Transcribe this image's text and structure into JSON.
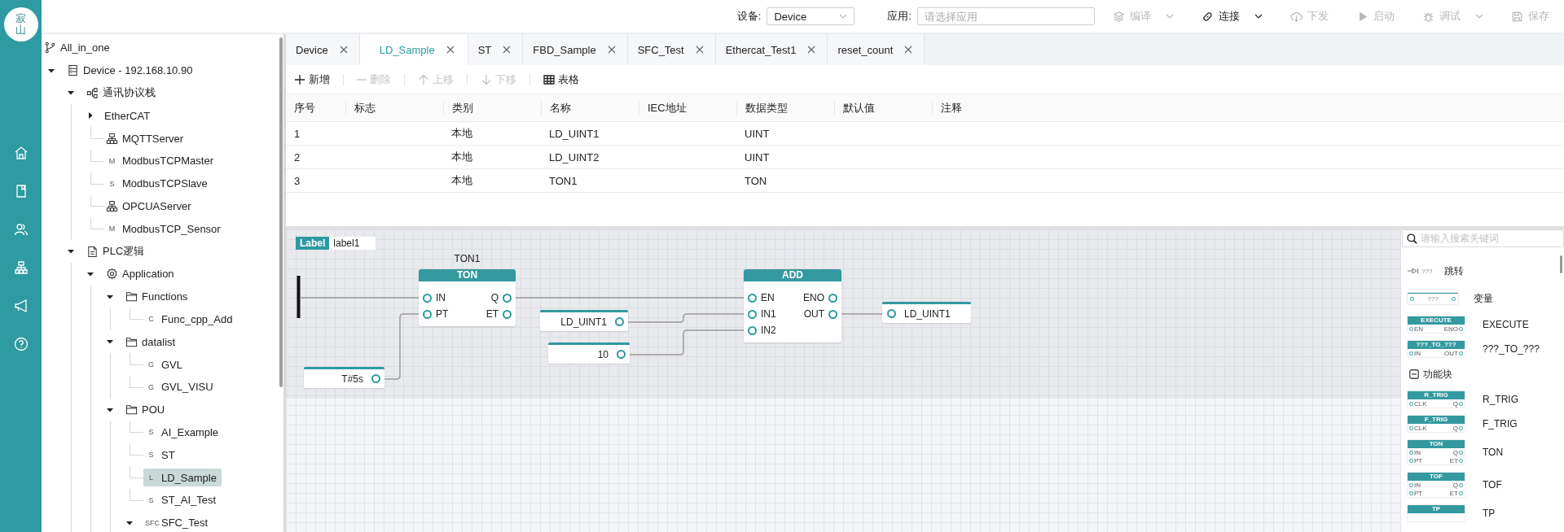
{
  "rail": {
    "logo_text": "寂山",
    "nav": [
      {
        "kind": "home"
      },
      {
        "kind": "book"
      },
      {
        "kind": "users"
      },
      {
        "kind": "network"
      },
      {
        "kind": "megaphone"
      },
      {
        "kind": "help"
      }
    ]
  },
  "topbar": {
    "device_label": "设备:",
    "device": "Device",
    "app_label": "应用:",
    "app_placeholder": "请选择应用",
    "actions": [
      {
        "kind": "compile",
        "label": "编译",
        "disabled": true,
        "dropdown": true
      },
      {
        "kind": "link",
        "label": "连接",
        "disabled": false,
        "dropdown": true
      },
      {
        "kind": "download",
        "label": "下发",
        "disabled": true,
        "dropdown": false
      },
      {
        "kind": "start",
        "label": "启动",
        "disabled": true,
        "dropdown": false
      },
      {
        "kind": "debug",
        "label": "调试",
        "disabled": true,
        "dropdown": true
      },
      {
        "kind": "save",
        "label": "保存",
        "disabled": true,
        "dropdown": false
      }
    ]
  },
  "tree": {
    "items": [
      {
        "label": "All_in_one",
        "kind": "branch",
        "selected": false,
        "children": [
          {
            "label": "Device - 192.168.10.90",
            "kind": "device",
            "selected": false,
            "expanded": true,
            "children": [
              {
                "label": "通讯协议栈",
                "kind": "nodes",
                "selected": false,
                "expanded": true,
                "children": [
                  {
                    "label": "EtherCAT",
                    "selected": false,
                    "expanded": false
                  },
                  {
                    "label": "MQTTServer",
                    "kind": "server",
                    "selected": false
                  },
                  {
                    "label": "ModbusTCPMaster",
                    "badge": "M",
                    "selected": false
                  },
                  {
                    "label": "ModbusTCPSlave",
                    "badge": "S",
                    "selected": false
                  },
                  {
                    "label": "OPCUAServer",
                    "kind": "server",
                    "selected": false
                  },
                  {
                    "label": "ModbusTCP_Sensor",
                    "badge": "M",
                    "selected": false
                  }
                ]
              },
              {
                "label": "PLC逻辑",
                "kind": "document",
                "selected": false,
                "expanded": true,
                "children": [
                  {
                    "label": "Application",
                    "kind": "gear",
                    "selected": false,
                    "expanded": true,
                    "children": [
                      {
                        "label": "Functions",
                        "kind": "folder",
                        "selected": false,
                        "expanded": true,
                        "children": [
                          {
                            "label": "Func_cpp_Add",
                            "badge": "C",
                            "selected": false
                          }
                        ]
                      },
                      {
                        "label": "datalist",
                        "kind": "folder",
                        "selected": false,
                        "expanded": true,
                        "children": [
                          {
                            "label": "GVL",
                            "badge": "G",
                            "selected": false
                          },
                          {
                            "label": "GVL_VISU",
                            "badge": "G",
                            "selected": false
                          }
                        ]
                      },
                      {
                        "label": "POU",
                        "kind": "folder",
                        "selected": false,
                        "expanded": true,
                        "children": [
                          {
                            "label": "AI_Example",
                            "badge": "S",
                            "selected": false
                          },
                          {
                            "label": "ST",
                            "badge": "S",
                            "selected": false
                          },
                          {
                            "label": "LD_Sample",
                            "badge": "L",
                            "selected": true
                          },
                          {
                            "label": "ST_AI_Test",
                            "badge": "S",
                            "selected": false
                          },
                          {
                            "label": "SFC_Test",
                            "badge": "SFC",
                            "selected": false,
                            "expanded": true
                          }
                        ]
                      }
                    ]
                  }
                ]
              }
            ]
          }
        ]
      }
    ]
  },
  "tabs": [
    {
      "label": "Device",
      "selected": false
    },
    {
      "label": "LD_Sample",
      "selected": true
    },
    {
      "label": "ST",
      "selected": false
    },
    {
      "label": "FBD_Sample",
      "selected": false
    },
    {
      "label": "SFC_Test",
      "selected": false
    },
    {
      "label": "Ethercat_Test1",
      "selected": false
    },
    {
      "label": "reset_count",
      "selected": false
    }
  ],
  "toolbar": [
    {
      "kind": "add",
      "label": "新增",
      "disabled": false
    },
    {
      "kind": "remove",
      "label": "删除",
      "disabled": true
    },
    {
      "kind": "up",
      "label": "上移",
      "disabled": true
    },
    {
      "kind": "down",
      "label": "下移",
      "disabled": true
    },
    {
      "kind": "table",
      "label": "表格",
      "disabled": false
    }
  ],
  "table": {
    "columns": [
      "序号",
      "标志",
      "类别",
      "名称",
      "IEC地址",
      "数据类型",
      "默认值",
      "注释"
    ],
    "rows": [
      {
        "index": "1",
        "category": "本地",
        "name": "LD_UINT1",
        "data_type": "UINT"
      },
      {
        "index": "2",
        "category": "本地",
        "name": "LD_UINT2",
        "data_type": "UINT"
      },
      {
        "index": "3",
        "category": "本地",
        "name": "TON1",
        "data_type": "TON"
      }
    ]
  },
  "network": {
    "label": {
      "tag": "Label",
      "name": "label1"
    },
    "blocks": [
      {
        "instance": "TON1",
        "type": "TON",
        "inputs": [
          "IN",
          "PT"
        ],
        "outputs": [
          "Q",
          "ET"
        ]
      },
      {
        "type": "ADD",
        "inputs": [
          "EN",
          "IN1",
          "IN2"
        ],
        "outputs": [
          "ENO",
          "OUT"
        ]
      }
    ],
    "variables": [
      {
        "kind": "input",
        "name": "LD_UINT1"
      },
      {
        "kind": "input",
        "name": "10"
      },
      {
        "kind": "input",
        "name": "T#5s"
      },
      {
        "kind": "output",
        "name": "LD_UINT1"
      }
    ]
  },
  "palette": {
    "search_placeholder": "请输入搜索关键词",
    "items": [
      {
        "kind": "jump",
        "preview": "???",
        "label": "跳转"
      },
      {
        "kind": "variable",
        "preview": "???",
        "label": "变量"
      },
      {
        "kind": "block",
        "title": "EXECUTE",
        "inputs": [
          "EN"
        ],
        "outputs": [
          "ENO"
        ],
        "label": "EXECUTE"
      },
      {
        "kind": "block",
        "title": "???_TO_???",
        "inputs": [
          "IN"
        ],
        "outputs": [
          "OUT"
        ],
        "label": "???_TO_???"
      },
      {
        "kind": "group",
        "label": "功能块",
        "expanded": true
      },
      {
        "kind": "block",
        "title": "R_TRIG",
        "inputs": [
          "CLK"
        ],
        "outputs": [
          "Q"
        ],
        "label": "R_TRIG"
      },
      {
        "kind": "block",
        "title": "F_TRIG",
        "inputs": [
          "CLK"
        ],
        "outputs": [
          "Q"
        ],
        "label": "F_TRIG"
      },
      {
        "kind": "block",
        "title": "TON",
        "inputs": [
          "IN",
          "PT"
        ],
        "outputs": [
          "Q",
          "ET"
        ],
        "label": "TON"
      },
      {
        "kind": "block",
        "title": "TOF",
        "inputs": [
          "IN",
          "PT"
        ],
        "outputs": [
          "Q",
          "ET"
        ],
        "label": "TOF"
      },
      {
        "kind": "block",
        "title": "TP",
        "label": "TP"
      }
    ]
  }
}
